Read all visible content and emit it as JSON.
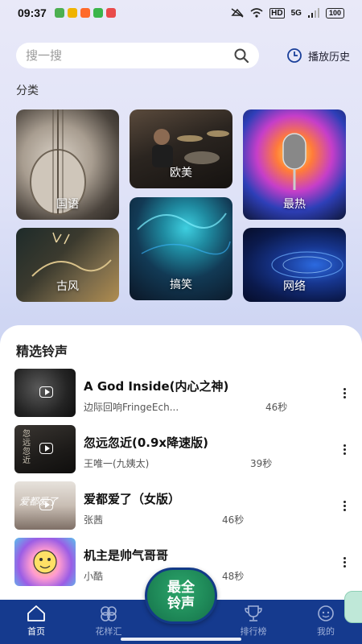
{
  "status_bar": {
    "time": "09:37",
    "battery": "100",
    "network": "5G",
    "hd": "HD"
  },
  "search": {
    "placeholder": "搜一搜"
  },
  "history": {
    "label": "播放历史"
  },
  "categories_title": "分类",
  "categories": [
    {
      "label": "国语"
    },
    {
      "label": "欧美"
    },
    {
      "label": "最热"
    },
    {
      "label": "古风"
    },
    {
      "label": "搞笑"
    },
    {
      "label": "网络"
    }
  ],
  "featured_title": "精选铃声",
  "songs": [
    {
      "title": "A God Inside(内心之神)",
      "artist": "边际回响FringeEch...",
      "duration": "46秒"
    },
    {
      "title": "忽远忽近(0.9x降速版)",
      "artist": "王唯一(九姨太)",
      "duration": "39秒"
    },
    {
      "title": "爱都爱了（女版）",
      "artist": "张茜",
      "duration": "46秒"
    },
    {
      "title": "机主是帅气哥哥",
      "artist": "小酷",
      "duration": "48秒"
    }
  ],
  "thumb_texts": [
    "忽远忽近",
    "爱都爱了"
  ],
  "center_button": {
    "line1": "最全",
    "line2": "铃声"
  },
  "tabs": [
    {
      "label": "首页",
      "icon": "home-icon"
    },
    {
      "label": "花样汇",
      "icon": "clover-icon"
    },
    {
      "label": "排行榜",
      "icon": "trophy-icon"
    },
    {
      "label": "我的",
      "icon": "face-icon"
    }
  ],
  "colors": {
    "tab_bar": "#153a8e",
    "fab_green": "#1f8a59",
    "accent_blue": "#1a3f9a"
  }
}
